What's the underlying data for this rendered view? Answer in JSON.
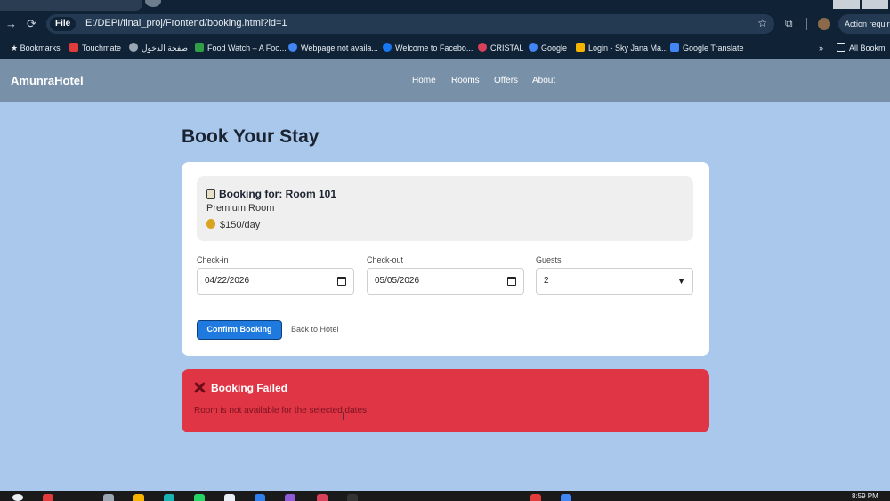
{
  "browser": {
    "file_chip": "File",
    "url": "E:/DEPI/final_proj/Frontend/booking.html?id=1",
    "action_chip": "Action require",
    "bookmarks": [
      {
        "label": "Bookmarks",
        "color": "#e8eef4"
      },
      {
        "label": "Touchmate",
        "color": "#e23b3b"
      },
      {
        "label": "صفحة الدخول",
        "color": "#9aa6b2"
      },
      {
        "label": "Food Watch – A Foo...",
        "color": "#2f9e44"
      },
      {
        "label": "Webpage not availa...",
        "color": "#4285f4"
      },
      {
        "label": "Welcome to Facebo...",
        "color": "#1877f2"
      },
      {
        "label": "CRISTAL",
        "color": "#d9415a"
      },
      {
        "label": "Google",
        "color": "#4285f4"
      },
      {
        "label": "Login - Sky Jana Ma...",
        "color": "#f5b400"
      },
      {
        "label": "Google Translate",
        "color": "#4285f4"
      }
    ],
    "all_bookmarks": "All Bookm"
  },
  "site": {
    "logo": "AmunraHotel",
    "nav": [
      "Home",
      "Rooms",
      "Offers",
      "About"
    ]
  },
  "booking": {
    "page_title": "Book Your Stay",
    "room_title": "Booking for: Room 101",
    "room_type": "Premium Room",
    "room_price": "$150/day",
    "checkin_label": "Check-in",
    "checkin_value": "04/22/2026",
    "checkout_label": "Check-out",
    "checkout_value": "05/05/2026",
    "guests_label": "Guests",
    "guests_value": "2",
    "confirm_label": "Confirm Booking",
    "back_label": "Back to Hotel"
  },
  "alert": {
    "title": "Booking Failed",
    "message": "Room is not available for the selected dates"
  },
  "taskbar": {
    "clock": "8:59 PM"
  },
  "colors": {
    "page_bg": "#a9c8ec",
    "header_bg": "#7890a8",
    "primary_button": "#1f7ae0",
    "error": "#e03545"
  }
}
